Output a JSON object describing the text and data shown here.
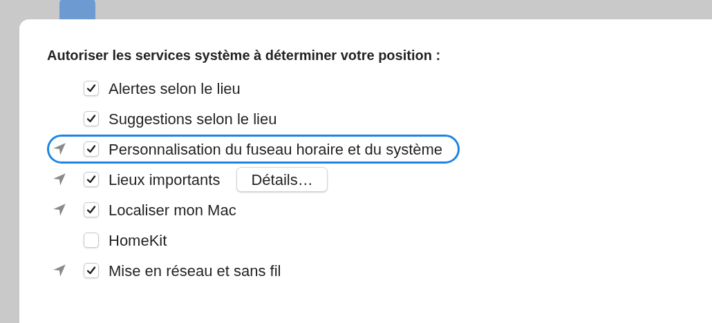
{
  "sheet": {
    "heading": "Autoriser les services système à déterminer votre position :",
    "services": [
      {
        "label": "Alertes selon le lieu",
        "checked": true,
        "location_icon": false,
        "highlighted": false
      },
      {
        "label": "Suggestions selon le lieu",
        "checked": true,
        "location_icon": false,
        "highlighted": false
      },
      {
        "label": "Personnalisation du fuseau horaire et du système",
        "checked": true,
        "location_icon": true,
        "highlighted": true
      },
      {
        "label": "Lieux importants",
        "checked": true,
        "location_icon": true,
        "highlighted": false,
        "button": "Détails…"
      },
      {
        "label": "Localiser mon Mac",
        "checked": true,
        "location_icon": true,
        "highlighted": false
      },
      {
        "label": "HomeKit",
        "checked": false,
        "location_icon": false,
        "highlighted": false
      },
      {
        "label": "Mise en réseau et sans fil",
        "checked": true,
        "location_icon": true,
        "highlighted": false
      }
    ]
  }
}
